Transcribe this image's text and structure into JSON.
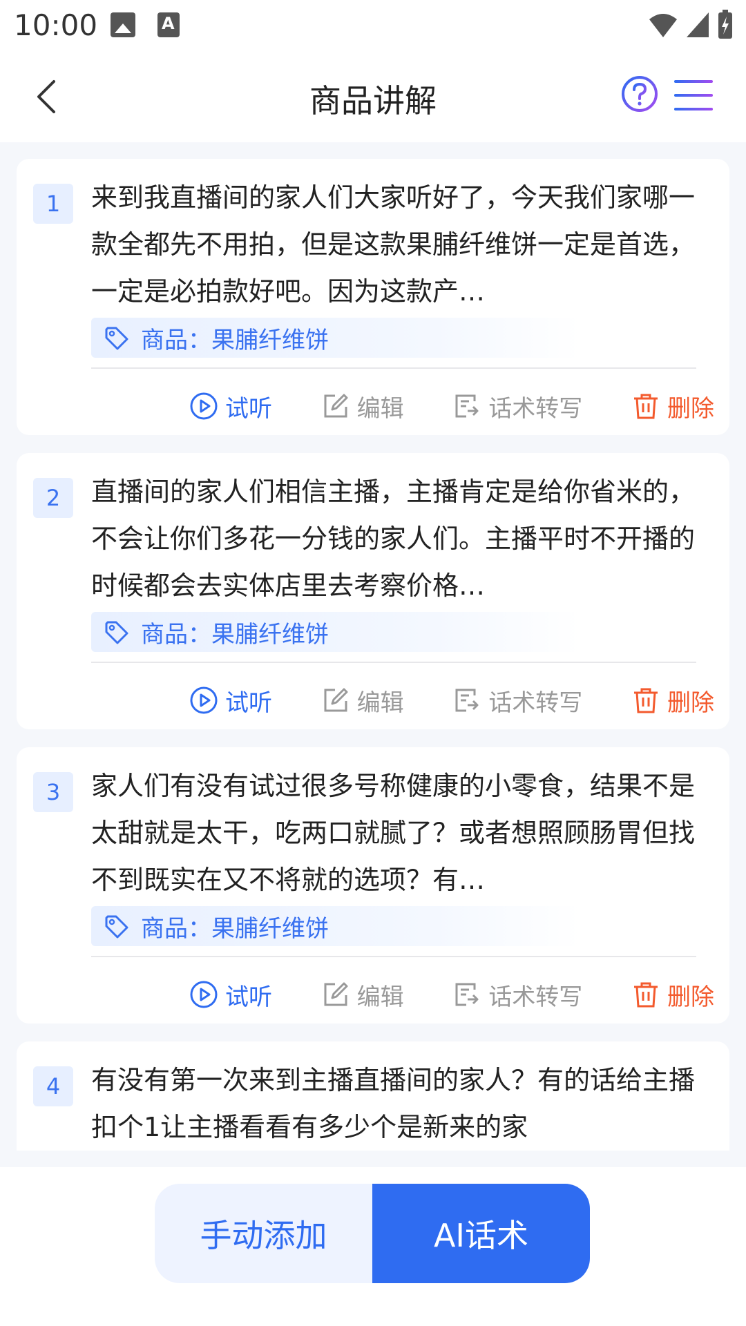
{
  "status": {
    "time": "10:00"
  },
  "header": {
    "title": "商品讲解"
  },
  "items": [
    {
      "index": "1",
      "text": "来到我直播间的家人们大家听好了，今天我们家哪一款全都先不用拍，但是这款果脯纤维饼一定是首选，一定是必拍款好吧。因为这款产…",
      "product": "商品：果脯纤维饼"
    },
    {
      "index": "2",
      "text": "直播间的家人们相信主播，主播肯定是给你省米的，不会让你们多花一分钱的家人们。主播平时不开播的时候都会去实体店里去考察价格…",
      "product": "商品：果脯纤维饼"
    },
    {
      "index": "3",
      "text": "家人们有没有试过很多号称健康的小零食，结果不是太甜就是太干，吃两口就腻了？或者想照顾肠胃但找不到既实在又不将就的选项？有…",
      "product": "商品：果脯纤维饼"
    },
    {
      "index": "4",
      "text": "有没有第一次来到主播直播间的家人？有的话给主播扣个1让主播看看有多少个是新来的家",
      "product": ""
    }
  ],
  "actions": {
    "play": "试听",
    "edit": "编辑",
    "convert": "话术转写",
    "delete": "删除"
  },
  "bottom": {
    "manual_add": "手动添加",
    "ai_script": "AI话术"
  },
  "colors": {
    "primary": "#2f6cf1",
    "danger": "#f35a2d",
    "muted": "#999999"
  }
}
